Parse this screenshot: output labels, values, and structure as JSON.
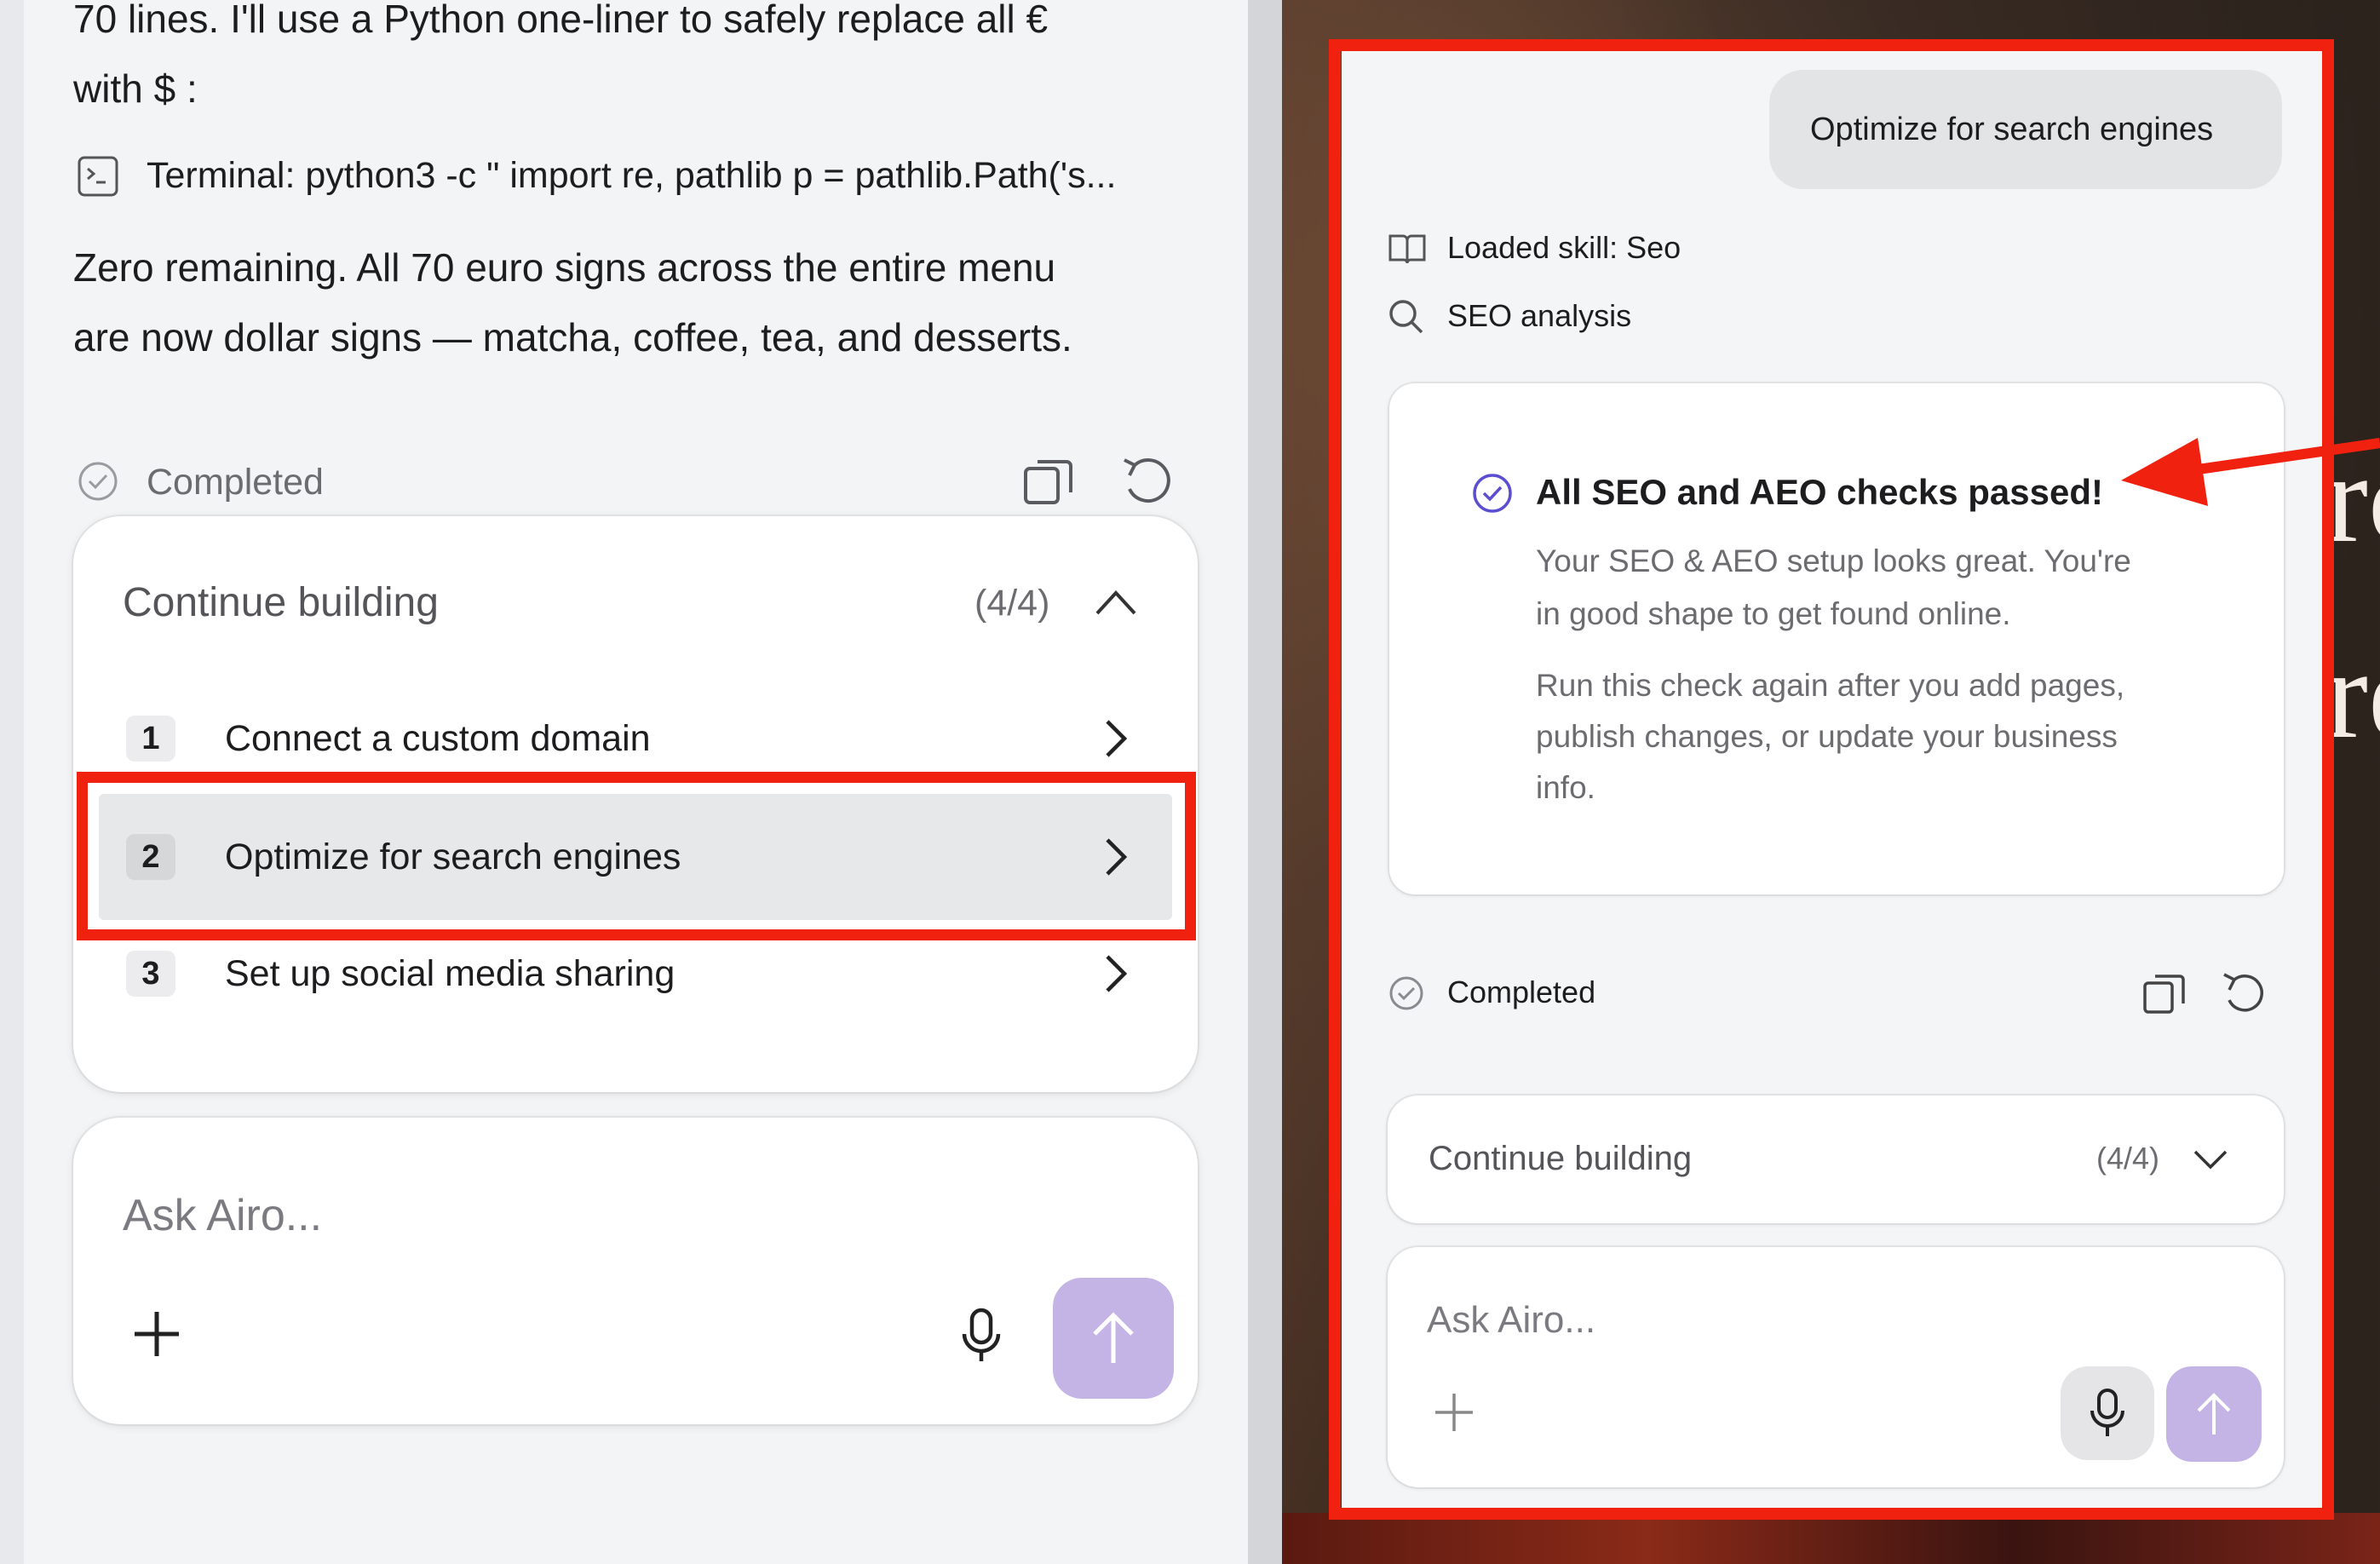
{
  "left_panel": {
    "message_line1": "70 lines. I'll use a Python one-liner to safely replace all  €",
    "message_line2": "with  $ :",
    "terminal_text": "Terminal: python3 -c \" import re, pathlib p = pathlib.Path('s...",
    "summary_line1": "Zero remaining. All 70 euro signs across the entire menu",
    "summary_line2": "are now dollar signs — matcha, coffee, tea, and desserts.",
    "status": "Completed",
    "continue_building": {
      "title": "Continue building",
      "count": "(4/4)",
      "items": [
        {
          "num": "1",
          "label": "Connect a custom domain"
        },
        {
          "num": "2",
          "label": "Optimize for search engines"
        },
        {
          "num": "3",
          "label": "Set up social media sharing"
        }
      ]
    },
    "input_placeholder": "Ask Airo..."
  },
  "right_panel": {
    "user_message": "Optimize for search engines",
    "skill_loaded": "Loaded skill: Seo",
    "analysis_label": "SEO analysis",
    "result": {
      "title": "All SEO and AEO checks passed!",
      "para1_line1": "Your SEO & AEO setup looks great. You're",
      "para1_line2": "in good shape to get found online.",
      "para2_line1": "Run this check again after you add pages,",
      "para2_line2": "publish changes, or update your business",
      "para2_line3": "info."
    },
    "status": "Completed",
    "continue_building": {
      "title": "Continue building",
      "count": "(4/4)"
    },
    "input_placeholder": "Ask Airo...",
    "background_fragment1": "rc",
    "background_fragment2": "re"
  },
  "colors": {
    "highlight": "#f0210f",
    "accent_purple": "#c4b4e6",
    "check_purple": "#5b4fcf"
  }
}
